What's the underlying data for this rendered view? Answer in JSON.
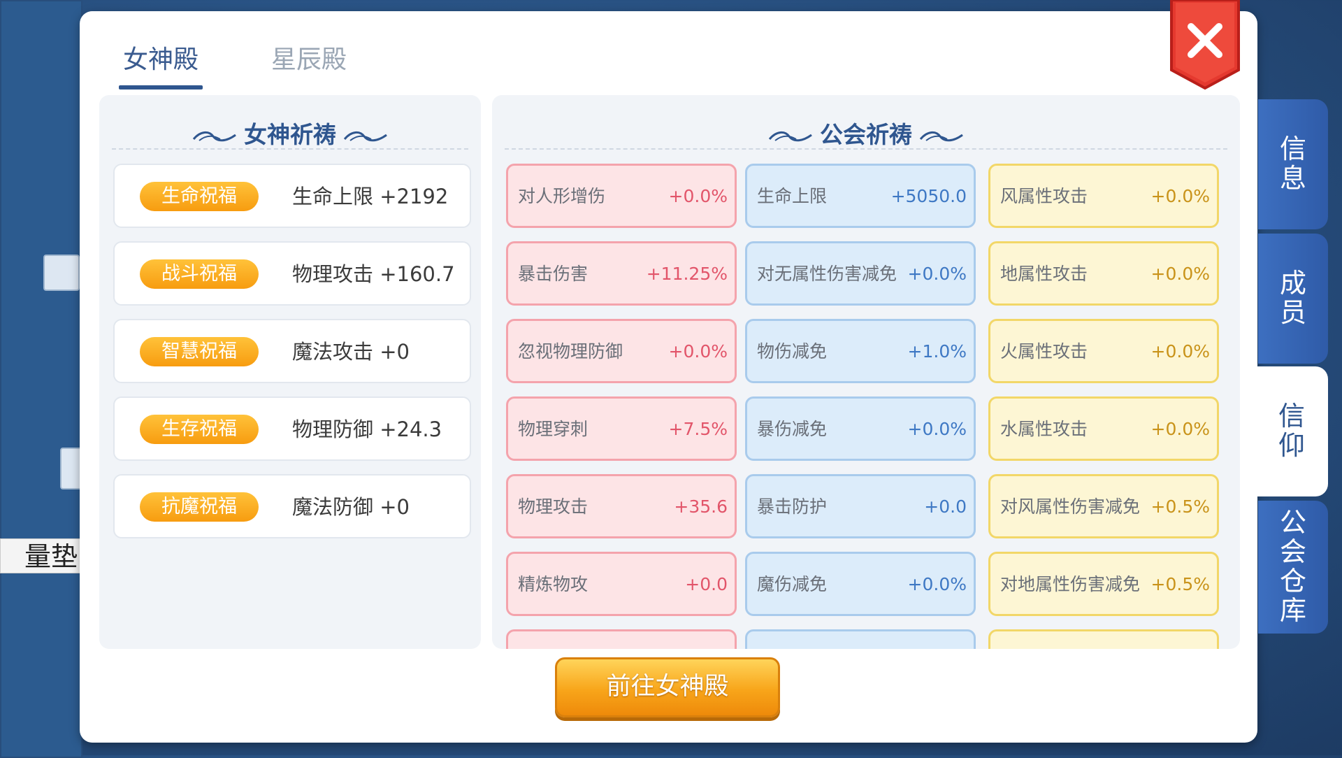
{
  "background": {
    "tooltip_text": "量垫子"
  },
  "header": {
    "tabs": [
      {
        "label": "女神殿",
        "active": true
      },
      {
        "label": "星辰殿",
        "active": false
      }
    ]
  },
  "goddess_prayer": {
    "title": "女神祈祷",
    "blessings": [
      {
        "badge": "生命祝福",
        "value": "生命上限 +2192"
      },
      {
        "badge": "战斗祝福",
        "value": "物理攻击 +160.7"
      },
      {
        "badge": "智慧祝福",
        "value": "魔法攻击 +0"
      },
      {
        "badge": "生存祝福",
        "value": "物理防御 +24.3"
      },
      {
        "badge": "抗魔祝福",
        "value": "魔法防御 +0"
      }
    ]
  },
  "guild_prayer": {
    "title": "公会祈祷",
    "rows": [
      [
        {
          "name": "对人形增伤",
          "value": "+0.0%"
        },
        {
          "name": "生命上限",
          "value": "+5050.0"
        },
        {
          "name": "风属性攻击",
          "value": "+0.0%"
        }
      ],
      [
        {
          "name": "暴击伤害",
          "value": "+11.25%"
        },
        {
          "name": "对无属性伤害减免",
          "value": "+0.0%"
        },
        {
          "name": "地属性攻击",
          "value": "+0.0%"
        }
      ],
      [
        {
          "name": "忽视物理防御",
          "value": "+0.0%"
        },
        {
          "name": "物伤减免",
          "value": "+1.0%"
        },
        {
          "name": "火属性攻击",
          "value": "+0.0%"
        }
      ],
      [
        {
          "name": "物理穿刺",
          "value": "+7.5%"
        },
        {
          "name": "暴伤减免",
          "value": "+0.0%"
        },
        {
          "name": "水属性攻击",
          "value": "+0.0%"
        }
      ],
      [
        {
          "name": "物理攻击",
          "value": "+35.6"
        },
        {
          "name": "暴击防护",
          "value": "+0.0"
        },
        {
          "name": "对风属性伤害减免",
          "value": "+0.5%"
        }
      ],
      [
        {
          "name": "精炼物攻",
          "value": "+0.0"
        },
        {
          "name": "魔伤减免",
          "value": "+0.0%"
        },
        {
          "name": "对地属性伤害减免",
          "value": "+0.5%"
        }
      ]
    ]
  },
  "footer": {
    "go_button": "前往女神殿"
  },
  "side_tabs": [
    {
      "label": "信\n息",
      "active": false
    },
    {
      "label": "成\n员",
      "active": false
    },
    {
      "label": "信\n仰",
      "active": true
    },
    {
      "label": "公\n会\n仓\n库",
      "active": false
    }
  ],
  "colors": {
    "accent": "#2f568f",
    "badge_orange": "#f79c10",
    "close_red": "#e5392f",
    "red_card": "#fde4e6",
    "blue_card": "#dcecfa",
    "yellow_card": "#fdf6d4"
  }
}
